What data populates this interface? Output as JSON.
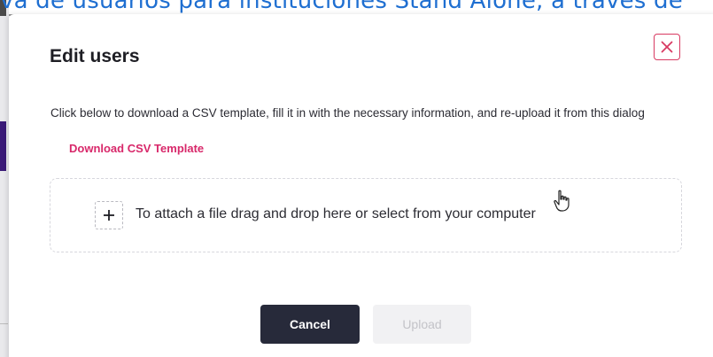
{
  "background": {
    "subtitle_fragment": "va de usuarios para instituciones Stand Alone, a través de"
  },
  "dialog": {
    "title": "Edit users",
    "close_icon": "close-x-icon",
    "instructions": "Click below to download a CSV template, fill it in with the necessary information, and re-upload it from this dialog",
    "download_link": "Download CSV Template",
    "dropzone": {
      "add_icon": "plus-icon",
      "text": "To attach a file drag and drop here or select from your computer"
    },
    "buttons": {
      "cancel": "Cancel",
      "upload": "Upload"
    }
  },
  "colors": {
    "accent": "#d8286a",
    "cancel_bg": "#272a3a",
    "upload_disabled_bg": "#f1f1f3",
    "background_text": "#1f6fd1"
  },
  "cursor": "hand-pointer-icon"
}
